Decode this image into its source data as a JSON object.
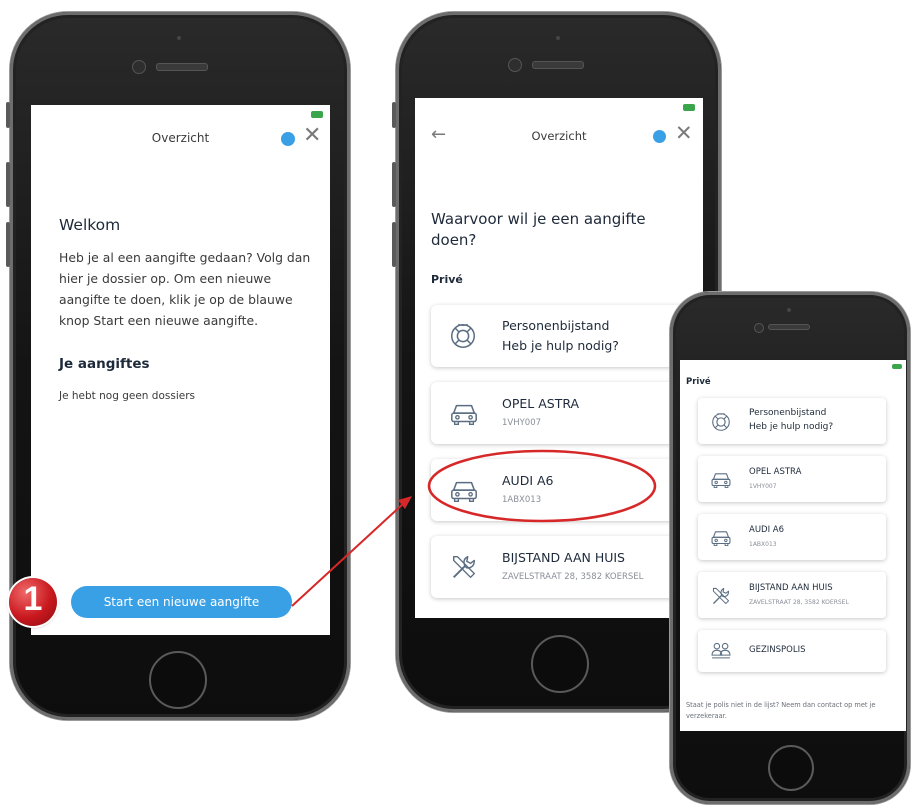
{
  "colors": {
    "accent": "#3aa0e6",
    "annotation": "#d62828",
    "card_text": "#1e2a3a",
    "muted": "#8a8f98"
  },
  "phone1": {
    "header_title": "Overzicht",
    "welcome_heading": "Welkom",
    "welcome_text": "Heb je al een aangifte gedaan? Volg dan hier je dossier op. Om een nieuwe aangifte te doen, klik je op de blauwe knop Start een nieuwe aangifte.",
    "aangiftes_heading": "Je aangiftes",
    "no_dossiers": "Je hebt nog geen dossiers",
    "start_button": "Start een nieuwe aangifte",
    "step_badge": "1",
    "icons": [
      "chat-bubble-icon",
      "close-icon"
    ]
  },
  "phone2": {
    "header_title": "Overzicht",
    "question": "Waarvoor wil je een aangifte doen?",
    "section": "Privé",
    "items": [
      {
        "title": "Personenbijstand",
        "subtitle": "Heb je hulp nodig?",
        "icon": "lifebuoy-icon"
      },
      {
        "title": "OPEL ASTRA",
        "subtitle": "1VHY007",
        "icon": "car-icon"
      },
      {
        "title": "AUDI A6",
        "subtitle": "1ABX013",
        "icon": "car-icon"
      },
      {
        "title": "BIJSTAND AAN HUIS",
        "subtitle": "ZAVELSTRAAT 28, 3582 KOERSEL",
        "icon": "tools-icon"
      }
    ]
  },
  "phone3": {
    "section": "Privé",
    "items": [
      {
        "title": "Personenbijstand",
        "subtitle": "Heb je hulp nodig?",
        "icon": "lifebuoy-icon"
      },
      {
        "title": "OPEL ASTRA",
        "subtitle": "1VHY007",
        "icon": "car-icon"
      },
      {
        "title": "AUDI A6",
        "subtitle": "1ABX013",
        "icon": "car-icon"
      },
      {
        "title": "BIJSTAND AAN HUIS",
        "subtitle": "ZAVELSTRAAT 28, 3582 KOERSEL",
        "icon": "tools-icon"
      },
      {
        "title": "GEZINSPOLIS",
        "subtitle": "",
        "icon": "family-icon"
      }
    ],
    "footer": "Staat je polis niet in de lijst? Neem dan contact op met je verzekeraar."
  }
}
